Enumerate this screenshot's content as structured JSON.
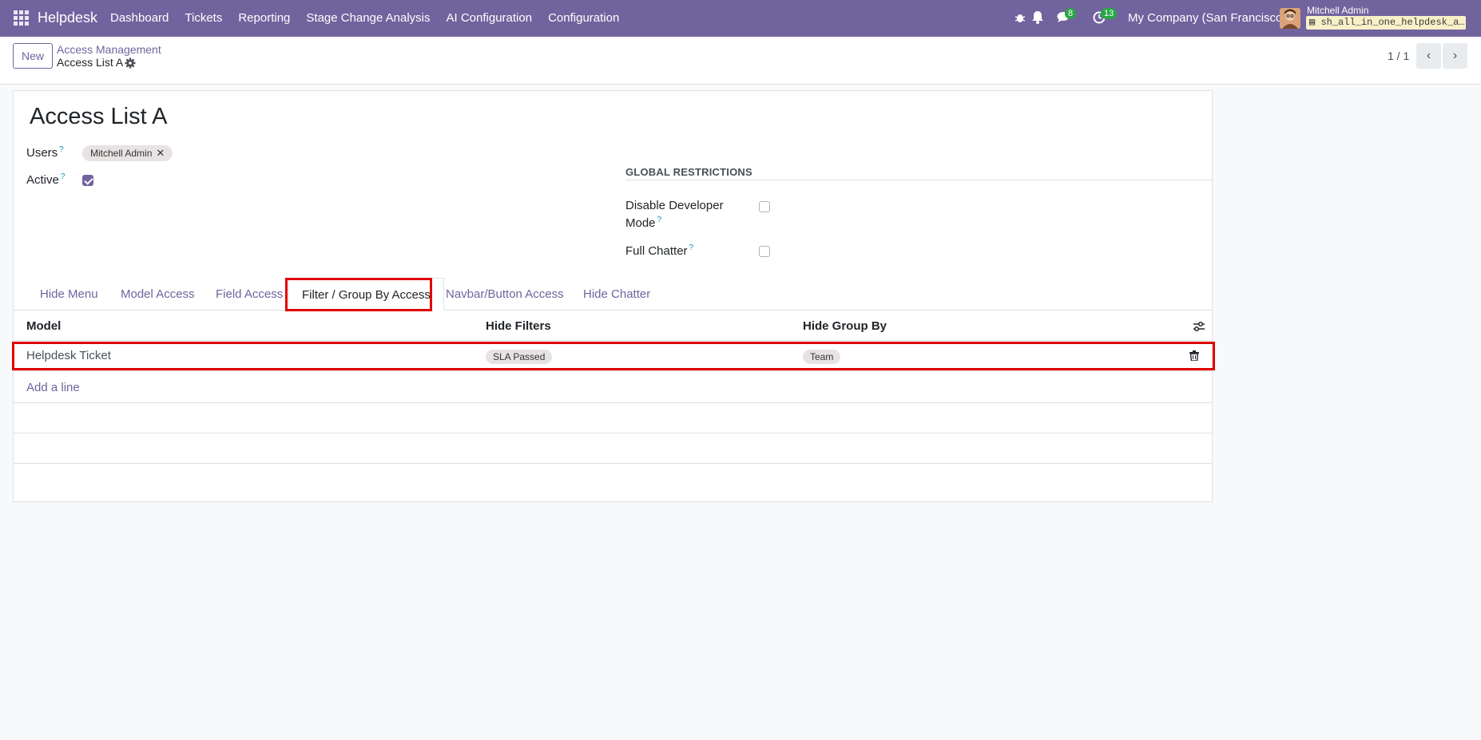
{
  "navbar": {
    "brand": "Helpdesk",
    "menu": [
      "Dashboard",
      "Tickets",
      "Reporting",
      "Stage Change Analysis",
      "AI Configuration",
      "Configuration"
    ],
    "chat_count": "8",
    "activity_count": "13",
    "company": "My Company (San Francisco)",
    "user_name": "Mitchell Admin",
    "database": "sh_all_in_one_helpdesk_a…"
  },
  "control": {
    "new_label": "New",
    "breadcrumb_parent": "Access Management",
    "breadcrumb_current": "Access List A",
    "pager": "1 / 1"
  },
  "form": {
    "title": "Access List A",
    "users_label": "Users",
    "users": [
      "Mitchell Admin"
    ],
    "active_label": "Active",
    "active": true,
    "global_title": "GLOBAL RESTRICTIONS",
    "disable_dev_label_1": "Disable Developer",
    "disable_dev_label_2": "Mode",
    "disable_dev": false,
    "full_chatter_label": "Full Chatter",
    "full_chatter": false
  },
  "tabs": [
    "Hide Menu",
    "Model Access",
    "Field Access",
    "Filter / Group By Access",
    "Navbar/Button Access",
    "Hide Chatter"
  ],
  "active_tab": "Filter / Group By Access",
  "table": {
    "headers": [
      "Model",
      "Hide Filters",
      "Hide Group By"
    ],
    "rows": [
      {
        "model": "Helpdesk Ticket",
        "filters": [
          "SLA Passed"
        ],
        "group_by": [
          "Team"
        ]
      }
    ],
    "add_line": "Add a line"
  },
  "colors": {
    "brand": "#71639e",
    "highlight": "#e00000",
    "badge": "#28a745"
  }
}
